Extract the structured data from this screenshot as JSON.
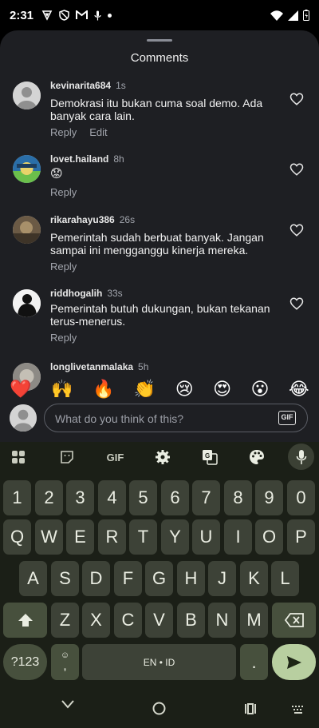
{
  "status_bar": {
    "time": "2:31",
    "icons": [
      "vpn-shield-icon",
      "shield-icon",
      "gmail-icon",
      "microphone-icon",
      "dot-icon"
    ],
    "right_icons": [
      "wifi-icon",
      "signal-icon",
      "battery-icon"
    ]
  },
  "sheet": {
    "title": "Comments"
  },
  "comments": [
    {
      "user": "kevinarita684",
      "time": "1s",
      "text": "Demokrasi itu bukan cuma soal demo. Ada banyak cara lain.",
      "actions": [
        "Reply",
        "Edit"
      ]
    },
    {
      "user": "lovet.hailand",
      "time": "8h",
      "text": "😟",
      "actions": [
        "Reply"
      ]
    },
    {
      "user": "rikarahayu386",
      "time": "26s",
      "text": "Pemerintah sudah berbuat banyak. Jangan sampai ini mengganggu kinerja mereka.",
      "actions": [
        "Reply"
      ]
    },
    {
      "user": "riddhogalih",
      "time": "33s",
      "text": "Pemerintah butuh dukungan, bukan tekanan terus-menerus.",
      "actions": [
        "Reply"
      ]
    },
    {
      "user": "longlivetanmalaka",
      "time": "5h"
    }
  ],
  "emoji_reactions": [
    "❤️",
    "🙌",
    "🔥",
    "👏",
    "😢",
    "😍",
    "😮",
    "😂"
  ],
  "input": {
    "placeholder": "What do you think of this?",
    "gif_label": "GIF"
  },
  "keyboard": {
    "toolbar": {
      "gif_label": "GIF",
      "icons": [
        "apps-grid-icon",
        "sticker-icon",
        "gif-icon",
        "settings-icon",
        "translate-icon",
        "palette-icon",
        "microphone-icon"
      ]
    },
    "row_numbers": [
      "1",
      "2",
      "3",
      "4",
      "5",
      "6",
      "7",
      "8",
      "9",
      "0"
    ],
    "row_top": [
      "Q",
      "W",
      "E",
      "R",
      "T",
      "Y",
      "U",
      "I",
      "O",
      "P"
    ],
    "row_middle": [
      "A",
      "S",
      "D",
      "F",
      "G",
      "H",
      "J",
      "K",
      "L"
    ],
    "row_bottom": [
      "Z",
      "X",
      "C",
      "V",
      "B",
      "N",
      "M"
    ],
    "symbols_label": "?123",
    "comma_label": ",",
    "space_label": "EN • ID",
    "period_label": ".",
    "colors": {
      "accent": "#b8cfa0",
      "key": "#3d4237",
      "background": "#1b1f17"
    }
  },
  "nav_bar": {
    "icons": [
      "back-chevron-icon",
      "home-circle-icon",
      "recents-icon",
      "keyboard-switch-icon"
    ]
  }
}
